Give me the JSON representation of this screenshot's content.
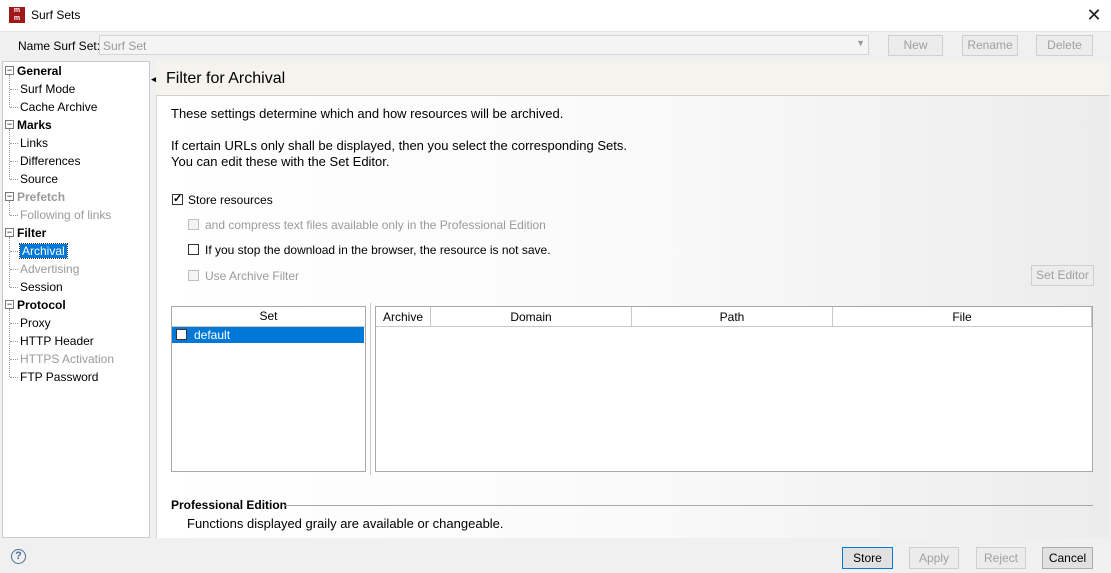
{
  "window": {
    "title": "Surf Sets",
    "app_icon_text": "m\nm"
  },
  "name_row": {
    "label": "Name Surf Set:",
    "value": "Surf Set",
    "buttons": {
      "new": "New",
      "rename": "Rename",
      "delete": "Delete"
    }
  },
  "tree": {
    "sections": [
      {
        "label": "General",
        "disabled": false,
        "items": [
          {
            "label": "Surf Mode",
            "disabled": false
          },
          {
            "label": "Cache Archive",
            "disabled": false
          }
        ]
      },
      {
        "label": "Marks",
        "disabled": false,
        "items": [
          {
            "label": "Links",
            "disabled": false
          },
          {
            "label": "Differences",
            "disabled": false
          },
          {
            "label": "Source",
            "disabled": false
          }
        ]
      },
      {
        "label": "Prefetch",
        "disabled": true,
        "items": [
          {
            "label": "Following of links",
            "disabled": true
          }
        ]
      },
      {
        "label": "Filter",
        "disabled": false,
        "items": [
          {
            "label": "Archival",
            "disabled": false,
            "selected": true
          },
          {
            "label": "Advertising",
            "disabled": true
          },
          {
            "label": "Session",
            "disabled": false
          }
        ]
      },
      {
        "label": "Protocol",
        "disabled": false,
        "items": [
          {
            "label": "Proxy",
            "disabled": false
          },
          {
            "label": "HTTP Header",
            "disabled": false
          },
          {
            "label": "HTTPS Activation",
            "disabled": true
          },
          {
            "label": "FTP Password",
            "disabled": false
          }
        ]
      }
    ]
  },
  "panel": {
    "title": "Filter for Archival",
    "intro": "These settings determine which and how resources will be archived.",
    "sets_line1": "If certain URLs only shall be displayed, then you select the corresponding Sets.",
    "sets_line2": "You can edit these with the Set Editor.",
    "options": {
      "store_resources": "Store resources",
      "compress": "and compress text files available only in the Professional Edition",
      "stop_download": "If you stop the download in the browser, the resource is not save.",
      "use_archive_filter": "Use Archive Filter"
    },
    "set_editor_button": "Set Editor",
    "set_list": {
      "header": "Set",
      "rows": [
        "default"
      ]
    },
    "archive_table": {
      "columns": [
        "Archive",
        "Domain",
        "Path",
        "File"
      ]
    },
    "professional": {
      "title": "Professional Edition",
      "text": "Functions displayed graily are available or changeable."
    }
  },
  "footer": {
    "help": "?",
    "buttons": {
      "store": "Store",
      "apply": "Apply",
      "reject": "Reject",
      "cancel": "Cancel"
    }
  }
}
